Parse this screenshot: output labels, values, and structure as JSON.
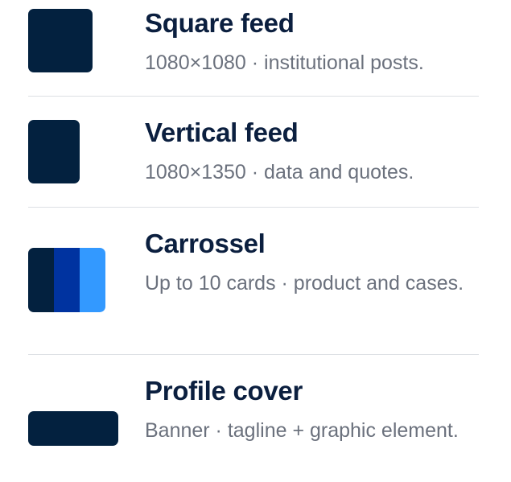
{
  "colors": {
    "navy": "#03213f",
    "blue": "#0033a0",
    "light_blue": "#3399ff",
    "title_text": "#0b1f3f",
    "desc_text": "#6b717d",
    "divider": "#dcdfe4"
  },
  "formats": [
    {
      "title": "Square feed",
      "description": "1080×1080 · institutional posts.",
      "thumbnail": "square-thumbnail"
    },
    {
      "title": "Vertical feed",
      "description": "1080×1350 · data and quotes.",
      "thumbnail": "vertical-thumbnail"
    },
    {
      "title": "Carrossel",
      "description": "Up to 10 cards · product and cases.",
      "thumbnail": "carousel-thumbnail"
    },
    {
      "title": "Profile cover",
      "description": "Banner · tagline + graphic element.",
      "thumbnail": "banner-thumbnail"
    }
  ]
}
